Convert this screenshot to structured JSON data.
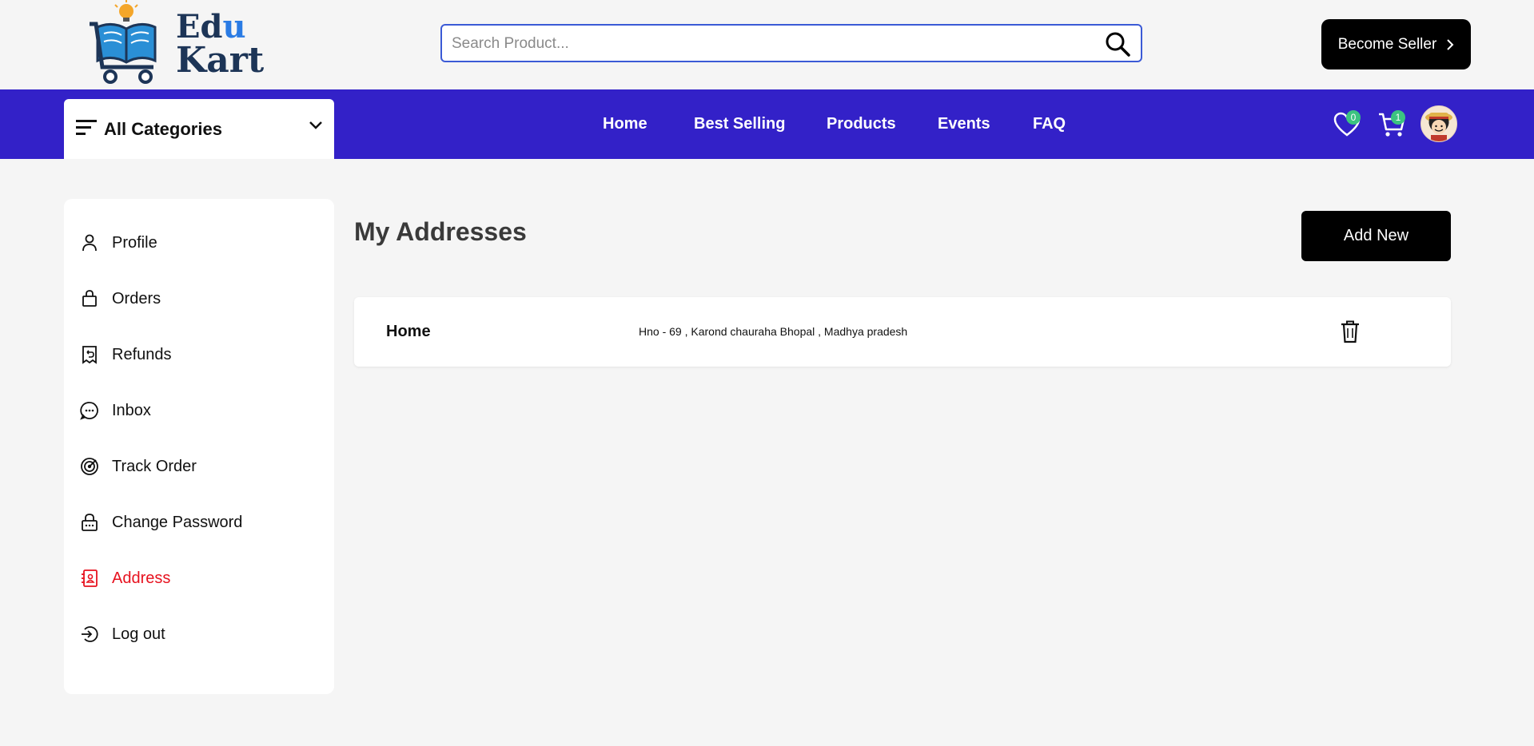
{
  "brand": {
    "name_line1_a": "Ed",
    "name_line1_b": "u",
    "name_line2": "Kart"
  },
  "search": {
    "placeholder": "Search Product...",
    "value": ""
  },
  "header": {
    "become_seller_label": "Become Seller"
  },
  "nav": {
    "categories_label": "All Categories",
    "links": [
      "Home",
      "Best Selling",
      "Products",
      "Events",
      "FAQ"
    ],
    "wishlist_count": "0",
    "cart_count": "1"
  },
  "sidebar": {
    "items": [
      {
        "label": "Profile",
        "icon": "person-icon"
      },
      {
        "label": "Orders",
        "icon": "shopping-bag-icon"
      },
      {
        "label": "Refunds",
        "icon": "receipt-refund-icon"
      },
      {
        "label": "Inbox",
        "icon": "chat-bubble-icon"
      },
      {
        "label": "Track Order",
        "icon": "track-target-icon"
      },
      {
        "label": "Change Password",
        "icon": "lock-password-icon"
      },
      {
        "label": "Address",
        "icon": "address-book-icon",
        "active": true
      },
      {
        "label": "Log out",
        "icon": "logout-icon"
      }
    ]
  },
  "main": {
    "title": "My Addresses",
    "add_new_label": "Add New",
    "addresses": [
      {
        "type": "Home",
        "text": "Hno - 69 , Karond chauraha Bhopal , Madhya pradesh"
      }
    ]
  },
  "colors": {
    "nav": "#3321c8",
    "active": "#e7121f",
    "badge": "#3bc380",
    "button": "#000000"
  }
}
